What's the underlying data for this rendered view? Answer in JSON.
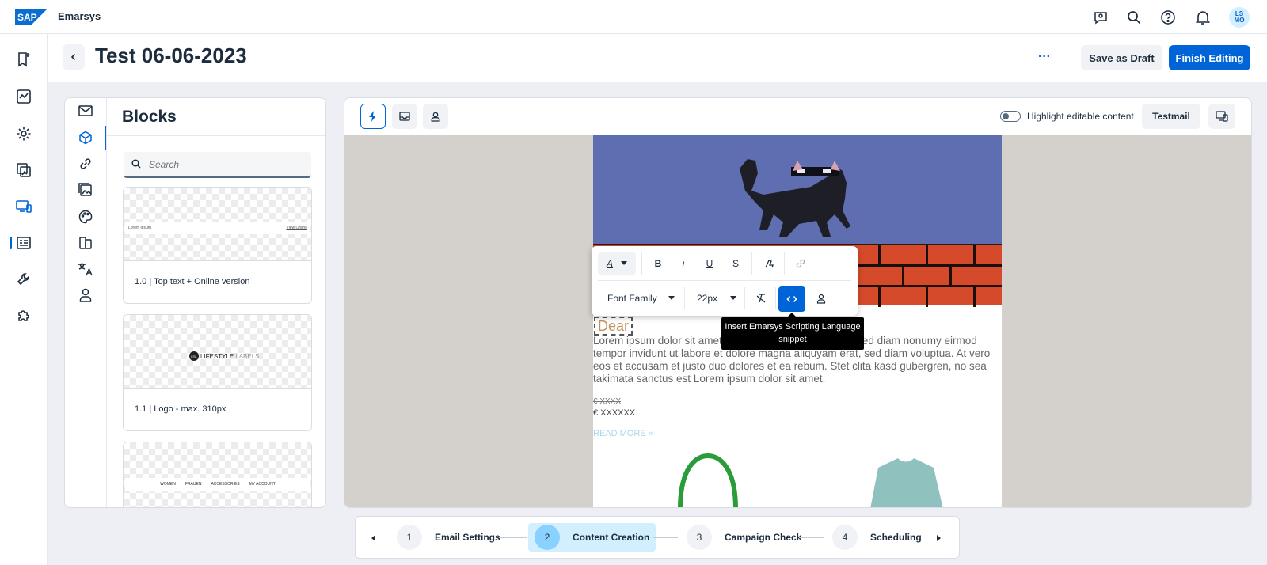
{
  "shell": {
    "product": "Emarsys",
    "logo_text": "SAP",
    "avatar_initials_1": "LS",
    "avatar_initials_2": "MO",
    "icons": [
      "chat-icon",
      "search-icon",
      "help-icon",
      "bell-icon"
    ]
  },
  "nav": {
    "items": [
      "bookmark-icon",
      "analytics-icon",
      "settings-icon",
      "image-icon",
      "channels-icon",
      "form-icon",
      "wrench-icon",
      "puzzle-icon"
    ],
    "active_index": 4
  },
  "header": {
    "title": "Test 06-06-2023",
    "more_label": "···",
    "save_draft_label": "Save as Draft",
    "finish_label": "Finish Editing"
  },
  "blocks": {
    "title": "Blocks",
    "search_placeholder": "Search",
    "cards": [
      {
        "label": "1.0 | Top text + Online version",
        "thumb_left": "Lorem ipsum",
        "thumb_right": "View Online"
      },
      {
        "label": "1.1 | Logo - max. 310px",
        "logo_text": "LIFESTYLE",
        "logo_suffix": "LABELS",
        "logo_mark": "ESL"
      },
      {
        "label": "",
        "menu": [
          "WOMEN",
          "FRAUEN",
          "ACCESSORIES",
          "MY ACCOUNT"
        ]
      }
    ]
  },
  "editor": {
    "highlight_label": "Highlight editable content",
    "testmail_label": "Testmail",
    "email": {
      "dear": "Dear",
      "lorem": "Lorem ipsum dolor sit amet, consetetur sadipscing elitr, sed diam nonumy eirmod tempor invidunt ut labore et dolore magna aliquyam erat, sed diam voluptua. At vero eos et accusam et justo duo dolores et ea rebum. Stet clita kasd gubergren, no sea takimata sanctus est Lorem ipsum dolor sit amet.",
      "price_old": "€ XXXX",
      "price_new": "€ XXXXXX",
      "read_more": "READ MORE »"
    },
    "rte": {
      "font_family": "Font Family",
      "font_size": "22px",
      "bold": "B",
      "italic": "i",
      "underline": "U",
      "strike": "S",
      "text_color": "A"
    },
    "tooltip": "Insert Emarsys Scripting Language snippet"
  },
  "stepper": {
    "steps": [
      {
        "num": "1",
        "label": "Email Settings"
      },
      {
        "num": "2",
        "label": "Content Creation"
      },
      {
        "num": "3",
        "label": "Campaign Check"
      },
      {
        "num": "4",
        "label": "Scheduling"
      }
    ],
    "active_index": 1
  },
  "colors": {
    "accent": "#0064d9",
    "active_step": "#d1efff",
    "sky": "#5e6eb0",
    "bricks": "#d44a2a"
  }
}
